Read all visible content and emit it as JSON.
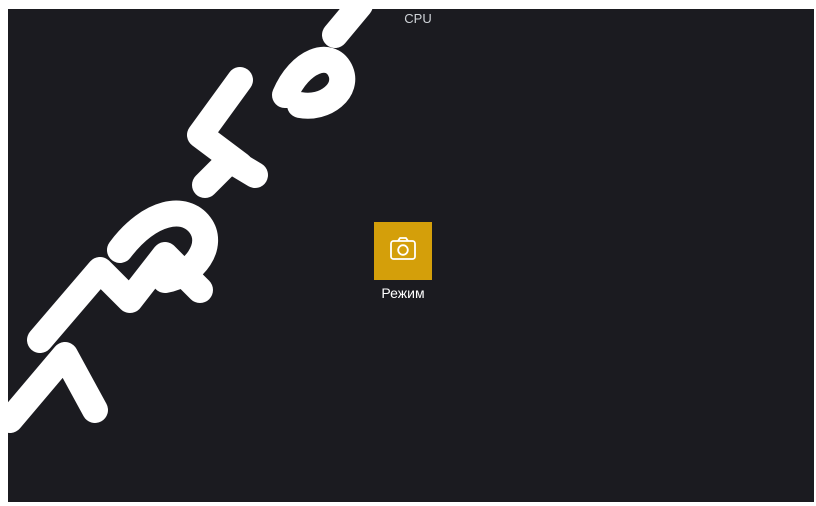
{
  "header": {
    "title": "CPU"
  },
  "main": {
    "mode_tile": {
      "label": "Режим",
      "icon": "camera-icon",
      "color": "#d49f0a"
    }
  },
  "watermark": {
    "text": "Amatel"
  },
  "colors": {
    "background": "#1b1b20",
    "accent": "#d49f0a",
    "text": "#ffffff"
  }
}
